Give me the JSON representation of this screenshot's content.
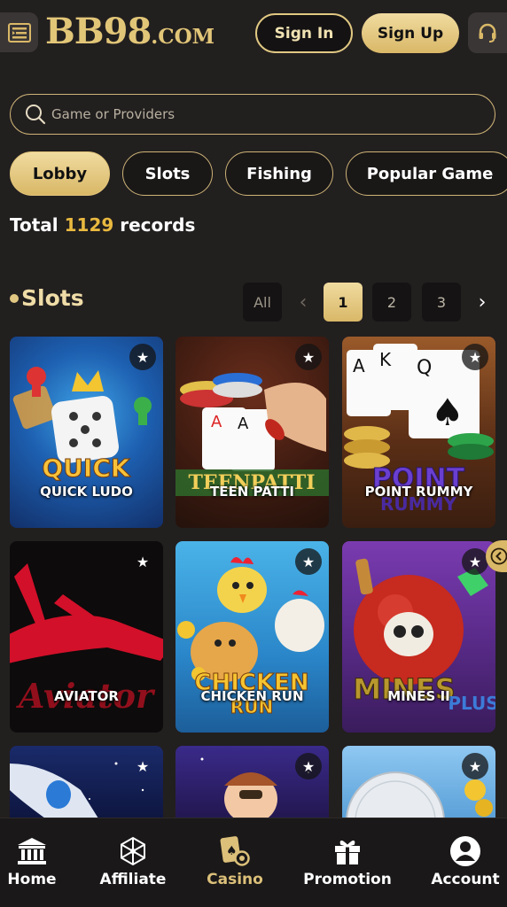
{
  "header": {
    "logo_main": "BB98",
    "logo_suffix": ".COM",
    "signin_label": "Sign In",
    "signup_label": "Sign Up"
  },
  "search": {
    "placeholder": "Game or Providers"
  },
  "tabs": [
    {
      "label": "Lobby",
      "active": true
    },
    {
      "label": "Slots",
      "active": false
    },
    {
      "label": "Fishing",
      "active": false
    },
    {
      "label": "Popular Game",
      "active": false
    }
  ],
  "records": {
    "prefix": "Total",
    "count": "1129",
    "suffix": "records"
  },
  "section": {
    "title": "Slots"
  },
  "pagination": {
    "all_label": "All",
    "prev": "‹",
    "pages": [
      "1",
      "2",
      "3"
    ],
    "current_page": "1",
    "next": "›"
  },
  "games": [
    {
      "name": "QUICK LUDO"
    },
    {
      "name": "TEEN PATTI"
    },
    {
      "name": "POINT RUMMY"
    },
    {
      "name": "AVIATOR"
    },
    {
      "name": "CHICKEN RUN"
    },
    {
      "name": "MINES II"
    },
    {
      "name": ""
    },
    {
      "name": ""
    },
    {
      "name": ""
    }
  ],
  "bottom_nav": [
    {
      "label": "Home",
      "icon": "bank-icon"
    },
    {
      "label": "Affiliate",
      "icon": "network-icon"
    },
    {
      "label": "Casino",
      "icon": "cards-icon",
      "active": true
    },
    {
      "label": "Promotion",
      "icon": "gift-icon"
    },
    {
      "label": "Account",
      "icon": "user-icon"
    }
  ],
  "colors": {
    "accent_gold": "#d9b867",
    "background": "#221f1f",
    "highlight_number": "#e9b93f"
  }
}
